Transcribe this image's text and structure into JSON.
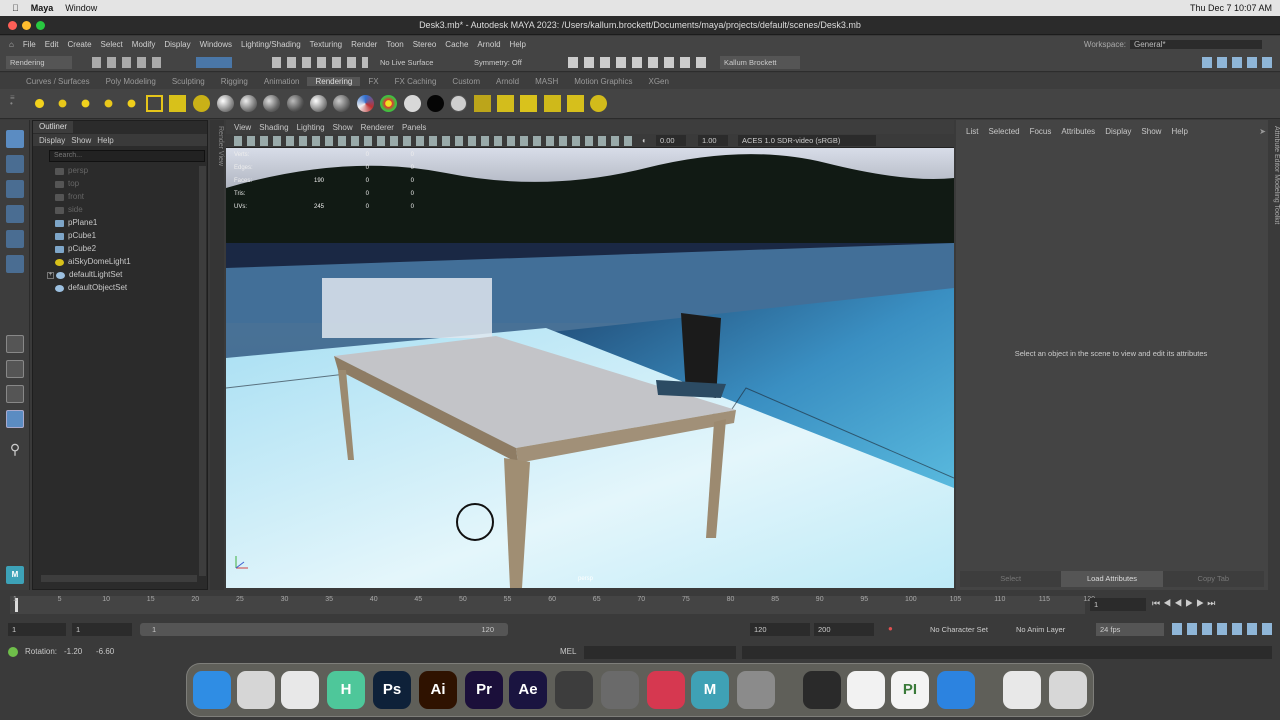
{
  "macbar": {
    "app": "Maya",
    "menus": [
      "Window"
    ],
    "clock": "Thu Dec 7  10:07 AM"
  },
  "window": {
    "title": "Desk3.mb* - Autodesk MAYA 2023: /Users/kallum.brockett/Documents/maya/projects/default/scenes/Desk3.mb"
  },
  "menubar": {
    "items": [
      "File",
      "Edit",
      "Create",
      "Select",
      "Modify",
      "Display",
      "Windows",
      "Lighting/Shading",
      "Texturing",
      "Render",
      "Toon",
      "Stereo",
      "Cache",
      "Arnold",
      "Help"
    ],
    "workspace_label": "Workspace:",
    "workspace_value": "General*"
  },
  "statusline": {
    "menuset": "Rendering",
    "live_surface": "No Live Surface",
    "symmetry": "Symmetry: Off",
    "user": "Kallum Brockett"
  },
  "shelftabs": {
    "items": [
      "Curves / Surfaces",
      "Poly Modeling",
      "Sculpting",
      "Rigging",
      "Animation",
      "Rendering",
      "FX",
      "FX Caching",
      "Custom",
      "Arnold",
      "MASH",
      "Motion Graphics",
      "XGen"
    ],
    "active": "Rendering"
  },
  "outliner": {
    "tab": "Outliner",
    "menus": [
      "Display",
      "Show",
      "Help"
    ],
    "search_placeholder": "Search...",
    "items": [
      {
        "label": "persp",
        "dim": true
      },
      {
        "label": "top",
        "dim": true
      },
      {
        "label": "front",
        "dim": true
      },
      {
        "label": "side",
        "dim": true
      },
      {
        "label": "pPlane1",
        "dim": false
      },
      {
        "label": "pCube1",
        "dim": false
      },
      {
        "label": "pCube2",
        "dim": false
      },
      {
        "label": "aiSkyDomeLight1",
        "dim": false
      },
      {
        "label": "defaultLightSet",
        "dim": false
      },
      {
        "label": "defaultObjectSet",
        "dim": false
      }
    ]
  },
  "render_view_label": "Render View",
  "viewport": {
    "menus": [
      "View",
      "Shading",
      "Lighting",
      "Show",
      "Renderer",
      "Panels"
    ],
    "exposure": "0.00",
    "gamma": "1.00",
    "colorspace": "ACES 1.0 SDR-video (sRGB)",
    "camera_label": "persp",
    "hud": [
      {
        "label": "Verts:",
        "a": "",
        "b": "0",
        "c": "0"
      },
      {
        "label": "Edges:",
        "a": "",
        "b": "0",
        "c": "0"
      },
      {
        "label": "Faces:",
        "a": "190",
        "b": "0",
        "c": "0"
      },
      {
        "label": "Tris:",
        "a": "",
        "b": "0",
        "c": "0"
      },
      {
        "label": "UVs:",
        "a": "245",
        "b": "0",
        "c": "0"
      }
    ]
  },
  "attribute_editor": {
    "menus": [
      "List",
      "Selected",
      "Focus",
      "Attributes",
      "Display",
      "Show",
      "Help"
    ],
    "message": "Select an object in the scene to view and edit its attributes",
    "buttons": [
      "Select",
      "Load Attributes",
      "Copy Tab"
    ],
    "side_tabs": "Attribute Editor    Modeling Toolkit"
  },
  "timeslider": {
    "ticks": [
      "1",
      "5",
      "10",
      "15",
      "20",
      "25",
      "30",
      "35",
      "40",
      "45",
      "50",
      "55",
      "60",
      "65",
      "70",
      "75",
      "80",
      "85",
      "90",
      "95",
      "100",
      "105",
      "110",
      "115",
      "120"
    ],
    "current_frame": "1"
  },
  "range": {
    "start": "1",
    "start2": "1",
    "slider_start": "1",
    "slider_end": "120",
    "end": "120",
    "end2": "200",
    "character_set": "No Character Set",
    "anim_layer": "No Anim Layer",
    "fps": "24 fps"
  },
  "cmdline": {
    "rotation_label": "Rotation:",
    "rot_a": "-1.20",
    "rot_b": "-6.60",
    "lang": "MEL"
  },
  "dock": {
    "apps": [
      {
        "name": "finder",
        "label": "",
        "color": "#2f8de4"
      },
      {
        "name": "launchpad",
        "label": "",
        "color": "#d6d6d6"
      },
      {
        "name": "chrome",
        "label": "",
        "color": "#e8e8e8"
      },
      {
        "name": "h-app",
        "label": "H",
        "color": "#4ec79a"
      },
      {
        "name": "photoshop",
        "label": "Ps",
        "color": "#0e2139"
      },
      {
        "name": "illustrator",
        "label": "Ai",
        "color": "#2f1200"
      },
      {
        "name": "premiere",
        "label": "Pr",
        "color": "#1b0f3a"
      },
      {
        "name": "aftereffects",
        "label": "Ae",
        "color": "#1a1440"
      },
      {
        "name": "blender",
        "label": "",
        "color": "#3d3d3d"
      },
      {
        "name": "unity",
        "label": "",
        "color": "#6a6a6a"
      },
      {
        "name": "x-app",
        "label": "",
        "color": "#d63850"
      },
      {
        "name": "maya",
        "label": "M",
        "color": "#3fa1b5"
      },
      {
        "name": "settings",
        "label": "",
        "color": "#8b8b8b"
      },
      {
        "name": "unity-hub",
        "label": "",
        "color": "#2a2a2a"
      },
      {
        "name": "shogun",
        "label": "",
        "color": "#f2f2f2"
      },
      {
        "name": "pi-app",
        "label": "PI",
        "color": "#f4f4f4"
      },
      {
        "name": "safari",
        "label": "",
        "color": "#2c83e0"
      },
      {
        "name": "document",
        "label": "",
        "color": "#e8e8e8"
      },
      {
        "name": "trash",
        "label": "",
        "color": "#d7d7d7"
      }
    ]
  }
}
